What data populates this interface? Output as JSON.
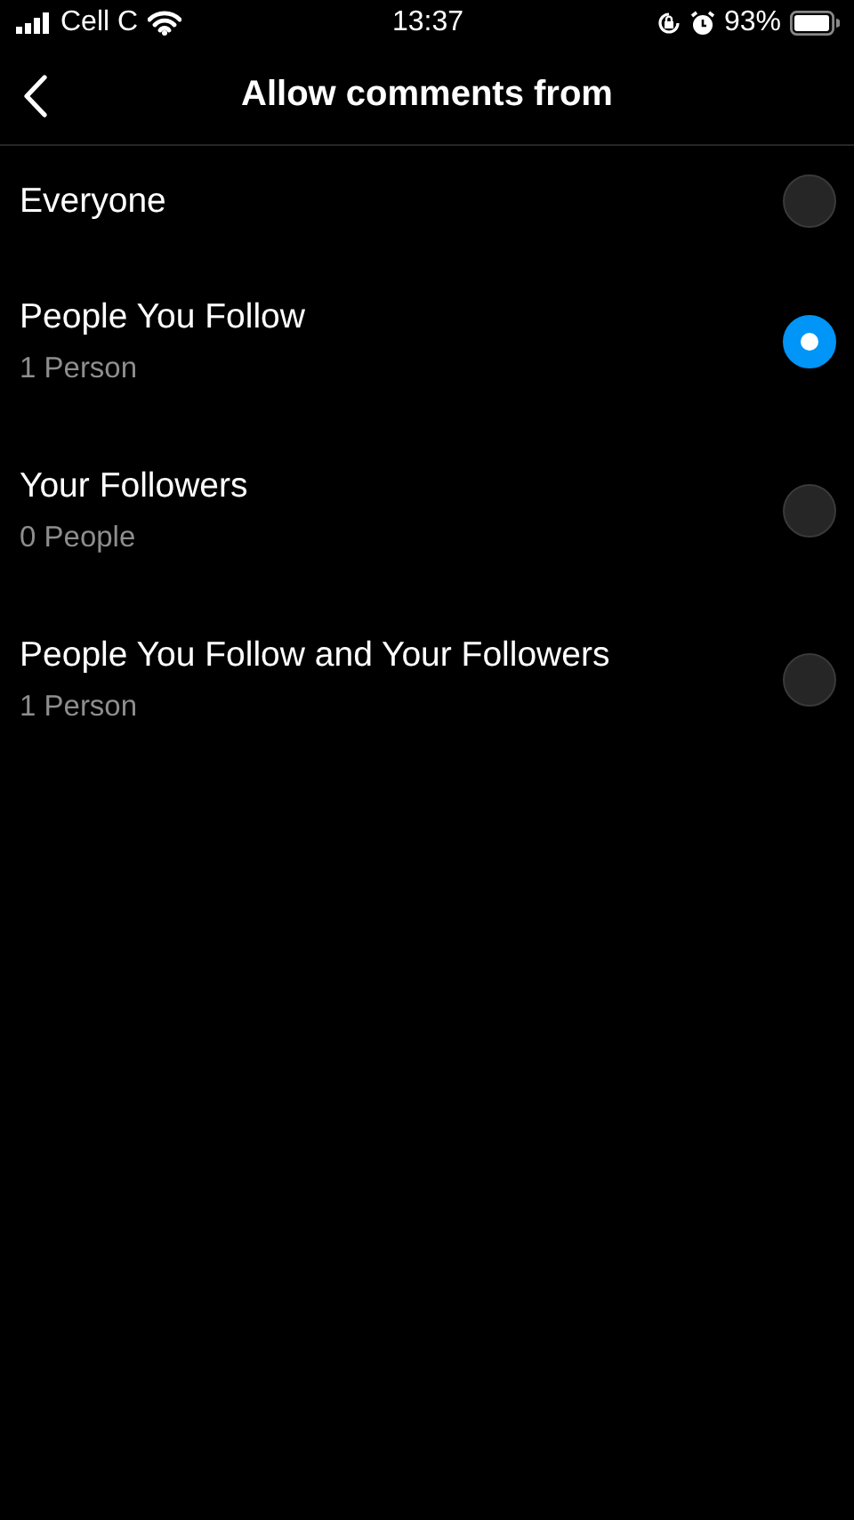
{
  "status_bar": {
    "carrier": "Cell C",
    "time": "13:37",
    "battery": "93%"
  },
  "header": {
    "title": "Allow comments from"
  },
  "options": [
    {
      "label": "Everyone",
      "selected": false
    },
    {
      "label": "People You Follow",
      "subtitle": "1 Person",
      "selected": true
    },
    {
      "label": "Your Followers",
      "subtitle": "0 People",
      "selected": false
    },
    {
      "label": "People You Follow and Your Followers",
      "subtitle": "1 Person",
      "selected": false
    }
  ]
}
